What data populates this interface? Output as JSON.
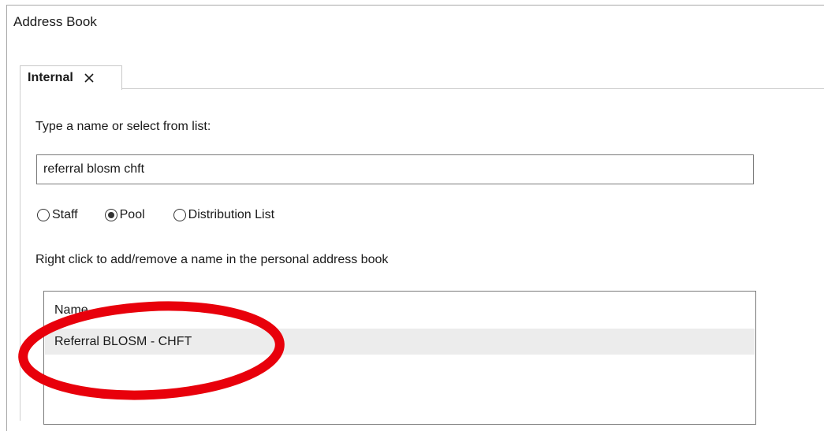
{
  "window": {
    "title": "Address Book"
  },
  "tabs": [
    {
      "label": "Internal",
      "close_icon": "close-icon"
    }
  ],
  "search": {
    "label": "Type a name or select from list:",
    "value": "referral blosm chft"
  },
  "filter": {
    "options": [
      {
        "label": "Staff",
        "selected": false
      },
      {
        "label": "Pool",
        "selected": true
      },
      {
        "label": "Distribution List",
        "selected": false
      }
    ]
  },
  "hint": "Right click to add/remove a name in the personal address book",
  "results": {
    "column_header": "Name",
    "rows": [
      {
        "name": "Referral BLOSM - CHFT",
        "highlighted": true
      }
    ]
  },
  "annotation": {
    "shape": "ellipse",
    "color": "#e8000b"
  }
}
